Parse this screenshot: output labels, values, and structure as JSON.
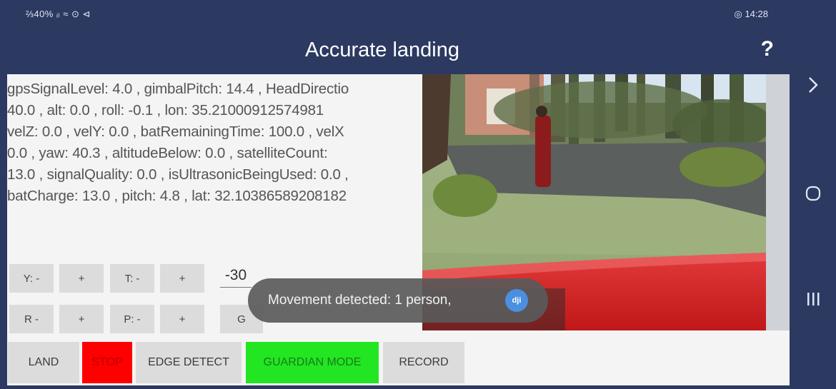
{
  "status_bar": {
    "left": "⅔40% ᵢₗ ≈ ⊙ ⊲",
    "time": "◎ 14:28"
  },
  "app_bar": {
    "title": "Accurate landing",
    "help": "?"
  },
  "telemetry": [
    "gpsSignalLevel: 4.0 , gimbalPitch: 14.4 , HeadDirectio",
    "40.0 , alt: 0.0 , roll: -0.1 , lon: 35.21000912574981",
    "velZ: 0.0 , velY: 0.0 , batRemainingTime: 100.0 , velX",
    "0.0 , yaw: 40.3 , altitudeBelow: 0.0 , satelliteCount:",
    "13.0 , signalQuality: 0.0 , isUltrasonicBeingUsed: 0.0 ,",
    "batCharge: 13.0 , pitch: 4.8 , lat: 32.10386589208182"
  ],
  "controls": {
    "yaw_minus": "Y: -",
    "yaw_plus": "+",
    "throttle_minus": "T: -",
    "throttle_plus": "+",
    "roll_minus": "R -",
    "roll_plus": "+",
    "pitch_minus": "P: -",
    "pitch_plus": "+",
    "gimbal_value": "-30",
    "gimbal_button": "G"
  },
  "actions": {
    "land": "LAND",
    "stop": "STOP",
    "edge_detect": "EDGE DETECT",
    "guardian_mode": "GUARDIAN MODE",
    "record": "RECORD"
  },
  "toast": {
    "message": "Movement detected: 1 person,",
    "icon_label": "dji"
  },
  "colors": {
    "app_bar": "#2c3a61",
    "stop": "#ff0000",
    "guardian": "#22e622",
    "button": "#dcdcdc"
  },
  "icons": [
    "chevron-right-icon",
    "home-icon",
    "recent-apps-icon",
    "dji-icon"
  ]
}
